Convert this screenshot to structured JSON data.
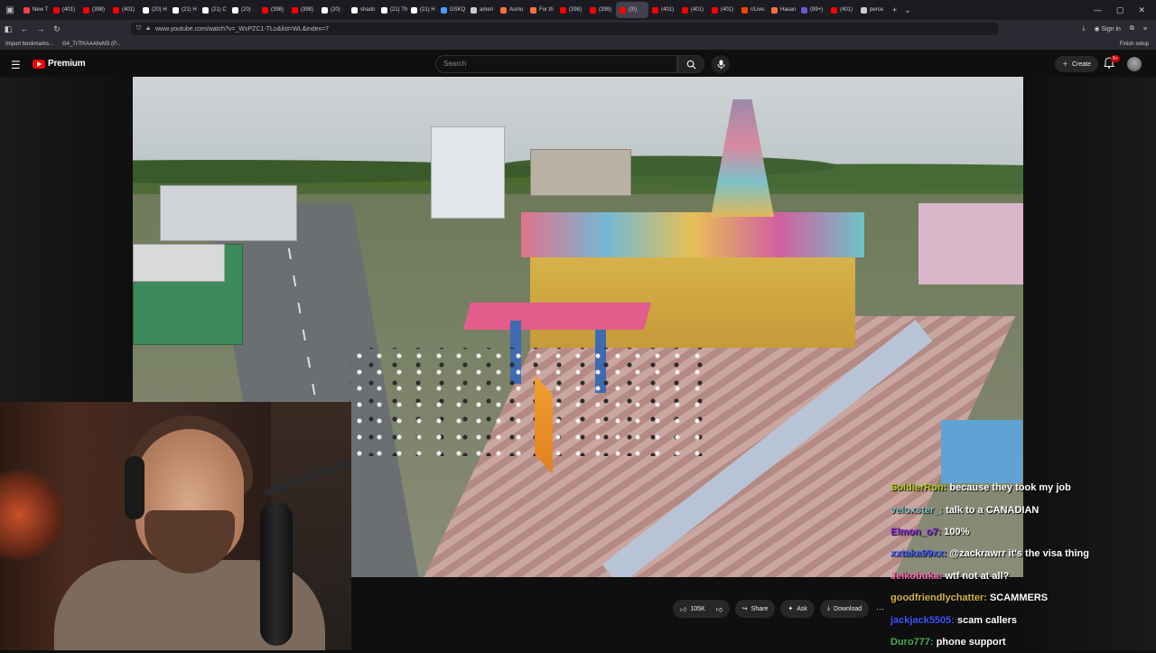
{
  "browser": {
    "tabs": [
      {
        "label": "New T",
        "color": "#ff4040"
      },
      {
        "label": "(401)",
        "color": "#ff0000"
      },
      {
        "label": "(398)",
        "color": "#ff0000"
      },
      {
        "label": "(401)",
        "color": "#ff0000"
      },
      {
        "label": "(20) H",
        "color": "#ffffff"
      },
      {
        "label": "(21) H",
        "color": "#ffffff"
      },
      {
        "label": "(21) C",
        "color": "#ffffff"
      },
      {
        "label": "(20) ·",
        "color": "#ffffff"
      },
      {
        "label": "(398)",
        "color": "#ff0000"
      },
      {
        "label": "(398)",
        "color": "#ff0000"
      },
      {
        "label": "(20) ·",
        "color": "#ffffff"
      },
      {
        "label": "shado",
        "color": "#ffffff"
      },
      {
        "label": "(21) Th",
        "color": "#ffffff"
      },
      {
        "label": "(21) H",
        "color": "#ffffff"
      },
      {
        "label": "GSKQ",
        "color": "#4a9df8"
      },
      {
        "label": "ameri",
        "color": "#cccccc"
      },
      {
        "label": "Asmo",
        "color": "#ff7040"
      },
      {
        "label": "For th",
        "color": "#ff7040"
      },
      {
        "label": "(398)",
        "color": "#ff0000"
      },
      {
        "label": "(399)",
        "color": "#ff0000"
      },
      {
        "label": "(3!)",
        "color": "#ff0000"
      },
      {
        "label": "(401)",
        "color": "#ff0000"
      },
      {
        "label": "(401)",
        "color": "#ff0000"
      },
      {
        "label": "(401)",
        "color": "#ff0000"
      },
      {
        "label": "r/Live:",
        "color": "#ff4500"
      },
      {
        "label": "Hasan",
        "color": "#ff7040"
      },
      {
        "label": "(99+)",
        "color": "#6e56cf"
      },
      {
        "label": "(401)",
        "color": "#ff0000"
      },
      {
        "label": "perce",
        "color": "#cccccc"
      }
    ],
    "active_tab_index": 20,
    "url": "www.youtube.com/watch?v=_WsPZC1-TLo&list=WL&index=7",
    "sign_in_label": "Sign in",
    "bookmarks": [
      "Import bookmarks...",
      "G4_7r7fXAAAhvM3 (P..."
    ],
    "finish_setup_label": "Finish setup"
  },
  "youtube": {
    "brand": "Premium",
    "search_placeholder": "Search",
    "create_label": "Create",
    "notif_count": "9+",
    "actions": {
      "like_count": "105K",
      "share_label": "Share",
      "ask_label": "Ask",
      "download_label": "Download",
      "more_label": "···"
    }
  },
  "chat": [
    {
      "user": "SoldierRon:",
      "msg": "because they took my job",
      "color": "#b5cc2a"
    },
    {
      "user": "veloxster_:",
      "msg": "talk to a CANADIAN",
      "color": "#7fbfbf"
    },
    {
      "user": "Elmon_o7:",
      "msg": "100%",
      "color": "#8a2be2"
    },
    {
      "user": "xxtaka99xx:",
      "msg": "@zackrawrr it's the visa thing",
      "color": "#3d5afe"
    },
    {
      "user": "Jeikobuka:",
      "msg": "wtf not at all?",
      "color": "#ff69b4"
    },
    {
      "user": "goodfriendlychatter:",
      "msg": "SCAMMERS",
      "color": "#d4b44a"
    },
    {
      "user": "jackjack5505:",
      "msg": "scam callers",
      "color": "#3d5afe"
    },
    {
      "user": "Duro777:",
      "msg": "phone support",
      "color": "#4caf50"
    }
  ]
}
